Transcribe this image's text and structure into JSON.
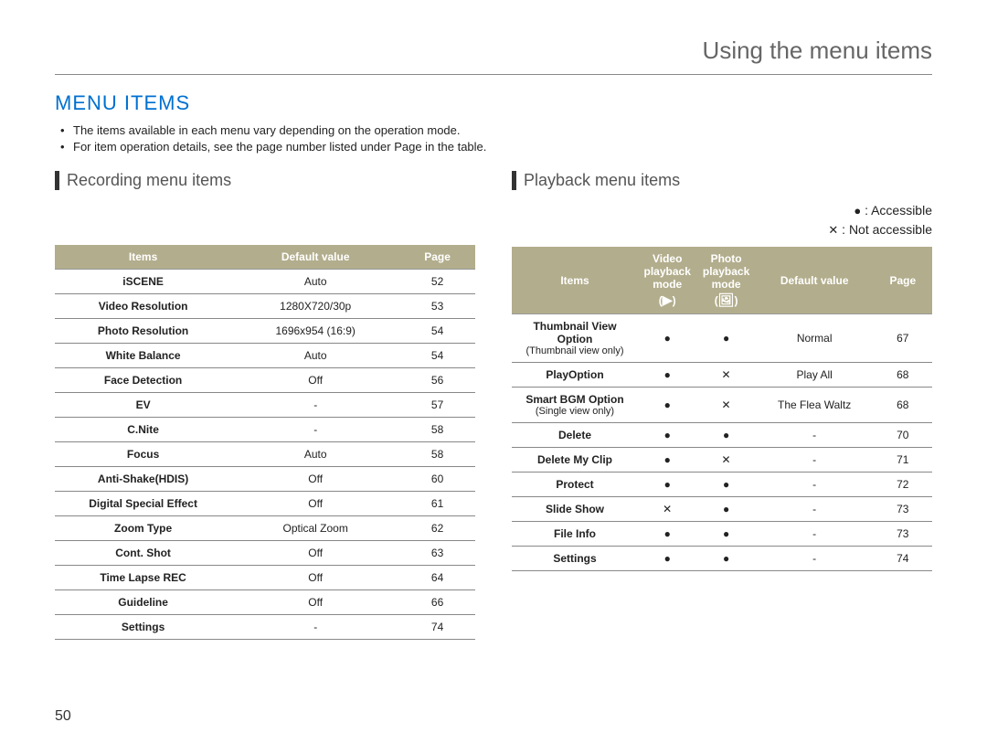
{
  "header": {
    "title": "Using the menu items"
  },
  "section_title": "MENU ITEMS",
  "bullets": [
    "The items available in each menu vary depending on the operation mode.",
    "For item operation details, see the page number listed under Page in the table."
  ],
  "page_number": "50",
  "legend": {
    "accessible_symbol": "●",
    "accessible_label": ": Accessible",
    "not_symbol": "✕",
    "not_label": ": Not accessible"
  },
  "recording": {
    "heading": "Recording menu items",
    "columns": {
      "items": "Items",
      "default": "Default value",
      "page": "Page"
    },
    "rows": [
      {
        "item": "iSCENE",
        "default": "Auto",
        "page": "52"
      },
      {
        "item": "Video Resolution",
        "default": "1280X720/30p",
        "page": "53"
      },
      {
        "item": "Photo Resolution",
        "default": "1696x954 (16:9)",
        "page": "54"
      },
      {
        "item": "White Balance",
        "default": "Auto",
        "page": "54"
      },
      {
        "item": "Face Detection",
        "default": "Off",
        "page": "56"
      },
      {
        "item": "EV",
        "default": "-",
        "page": "57"
      },
      {
        "item": "C.Nite",
        "default": "-",
        "page": "58"
      },
      {
        "item": "Focus",
        "default": "Auto",
        "page": "58"
      },
      {
        "item": "Anti-Shake(HDIS)",
        "default": "Off",
        "page": "60"
      },
      {
        "item": "Digital Special Effect",
        "default": "Off",
        "page": "61"
      },
      {
        "item": "Zoom Type",
        "default": "Optical Zoom",
        "page": "62"
      },
      {
        "item": "Cont. Shot",
        "default": "Off",
        "page": "63"
      },
      {
        "item": "Time Lapse REC",
        "default": "Off",
        "page": "64"
      },
      {
        "item": "Guideline",
        "default": "Off",
        "page": "66"
      },
      {
        "item": "Settings",
        "default": "-",
        "page": "74"
      }
    ]
  },
  "playback": {
    "heading": "Playback menu items",
    "columns": {
      "items": "Items",
      "video_mode": "Video playback mode",
      "photo_mode": "Photo playback mode",
      "default": "Default value",
      "page": "Page"
    },
    "mode_icons": {
      "video": "▶",
      "photo": "🖼"
    },
    "rows": [
      {
        "item": "Thumbnail View Option",
        "sub": "(Thumbnail view only)",
        "video": "●",
        "photo": "●",
        "default": "Normal",
        "page": "67"
      },
      {
        "item": "PlayOption",
        "sub": "",
        "video": "●",
        "photo": "✕",
        "default": "Play All",
        "page": "68"
      },
      {
        "item": "Smart BGM Option",
        "sub": "(Single view only)",
        "video": "●",
        "photo": "✕",
        "default": "The Flea Waltz",
        "page": "68"
      },
      {
        "item": "Delete",
        "sub": "",
        "video": "●",
        "photo": "●",
        "default": "-",
        "page": "70"
      },
      {
        "item": "Delete My Clip",
        "sub": "",
        "video": "●",
        "photo": "✕",
        "default": "-",
        "page": "71"
      },
      {
        "item": "Protect",
        "sub": "",
        "video": "●",
        "photo": "●",
        "default": "-",
        "page": "72"
      },
      {
        "item": "Slide Show",
        "sub": "",
        "video": "✕",
        "photo": "●",
        "default": "-",
        "page": "73"
      },
      {
        "item": "File Info",
        "sub": "",
        "video": "●",
        "photo": "●",
        "default": "-",
        "page": "73"
      },
      {
        "item": "Settings",
        "sub": "",
        "video": "●",
        "photo": "●",
        "default": "-",
        "page": "74"
      }
    ]
  }
}
